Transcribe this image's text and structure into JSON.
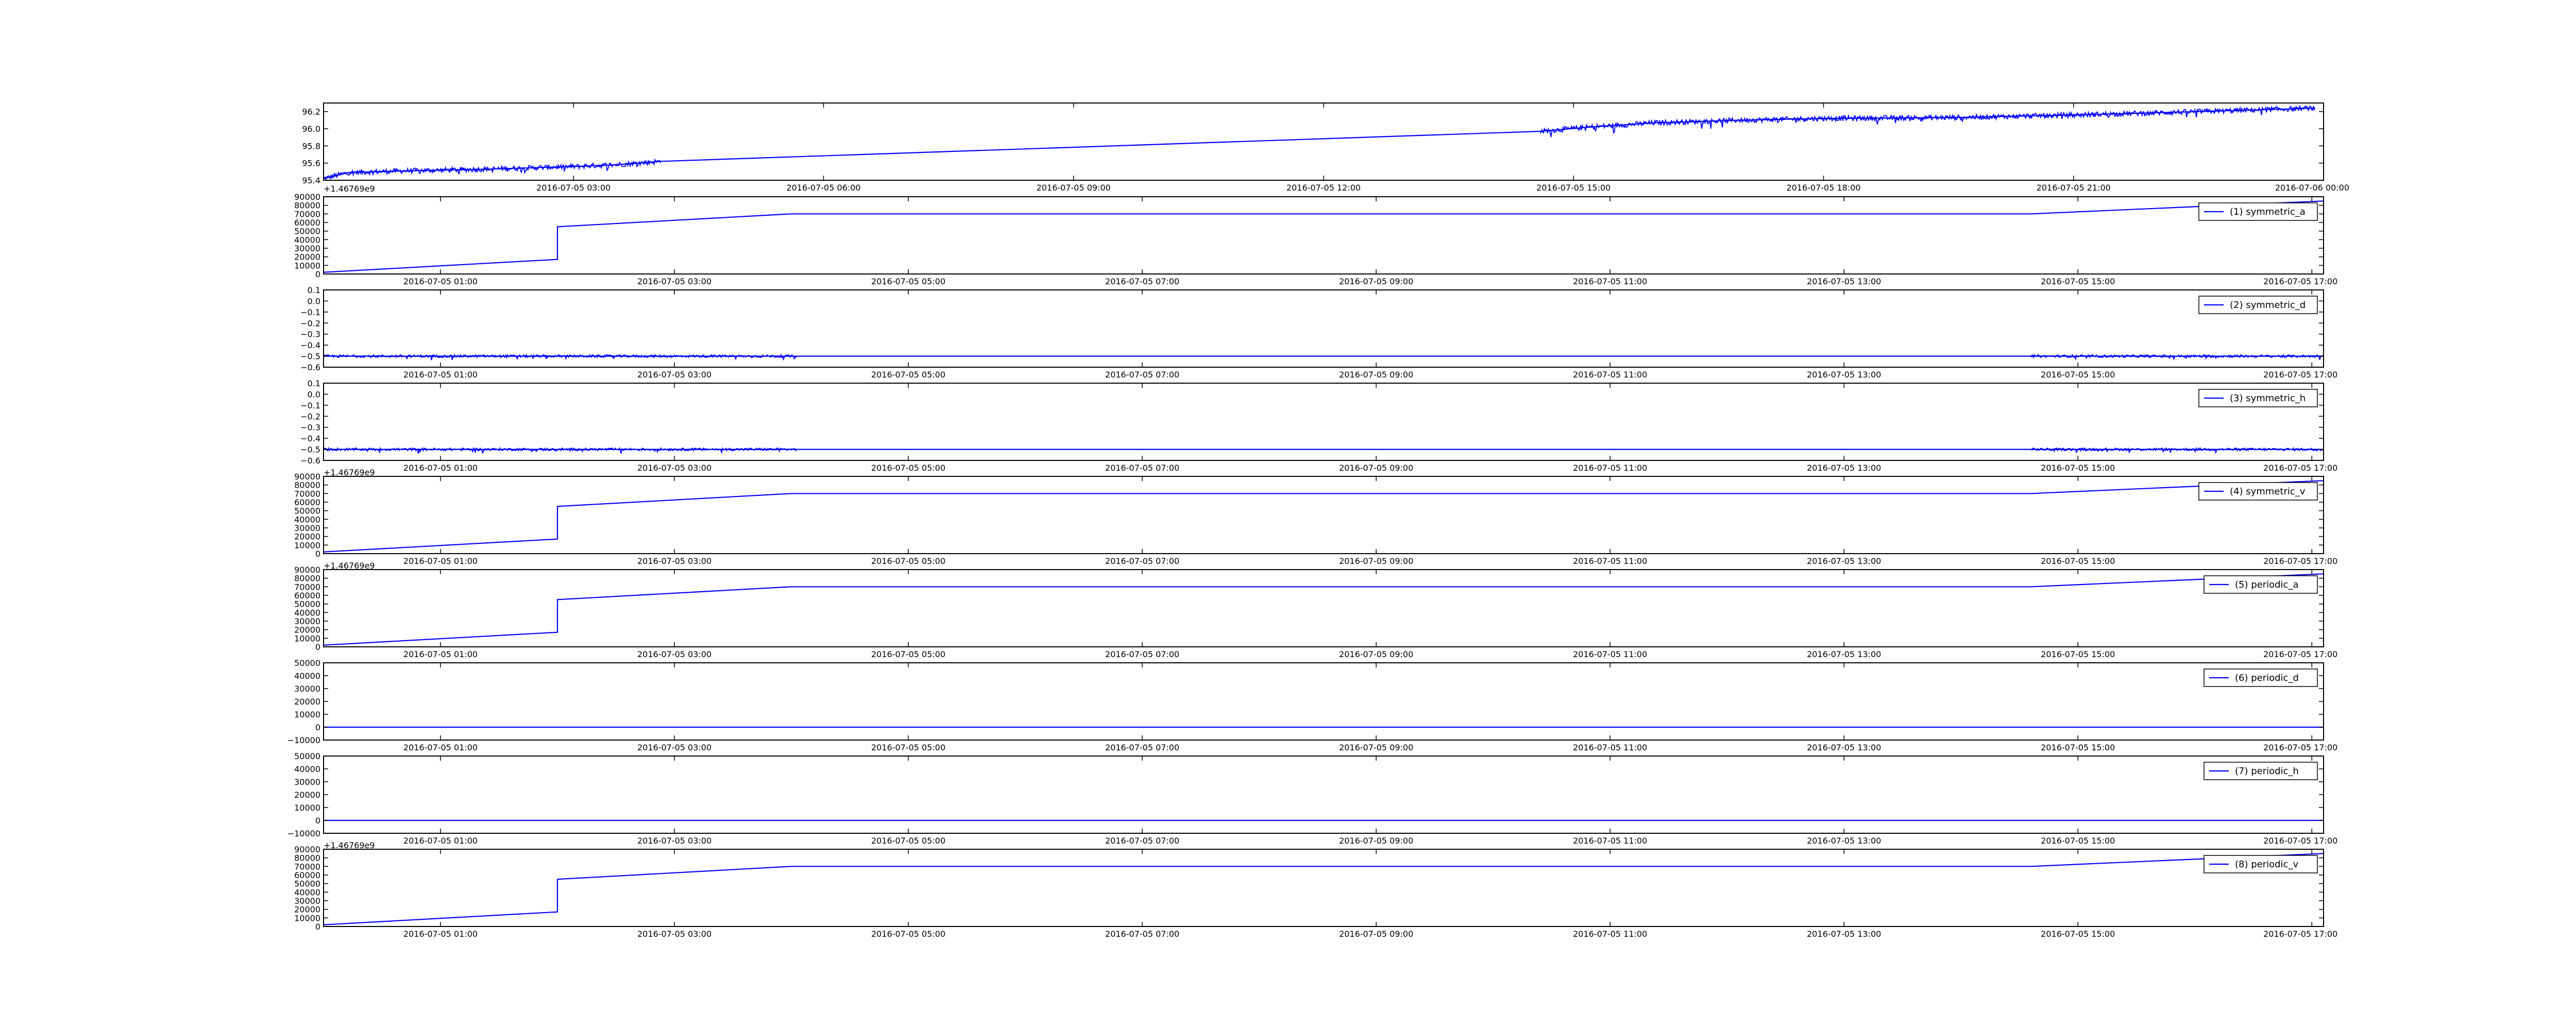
{
  "line_color": "#0000ff",
  "axis_color": "#000000",
  "chart_data": [
    {
      "id": "top",
      "type": "line",
      "offset_text": "+1.46769e9",
      "ylim": [
        95.4,
        96.3
      ],
      "yticks": [
        "95.4",
        "95.6",
        "95.8",
        "96.0",
        "96.2"
      ],
      "ytick_values": [
        95.4,
        95.6,
        95.8,
        96.0,
        96.2
      ],
      "xlim": [
        0.0,
        24.0
      ],
      "xticks": [
        "2016-07-05 03:00",
        "2016-07-05 06:00",
        "2016-07-05 09:00",
        "2016-07-05 12:00",
        "2016-07-05 15:00",
        "2016-07-05 18:00",
        "2016-07-05 21:00",
        "2016-07-06 00:00"
      ],
      "xtick_values": [
        3,
        6,
        9,
        12,
        15,
        18,
        21,
        24
      ],
      "legend": "",
      "noise": 0.03,
      "noise_segments": [
        [
          0.0,
          4.05
        ],
        [
          14.6,
          23.9
        ]
      ],
      "x": [
        0.0,
        0.3,
        1.0,
        2.0,
        3.0,
        3.5,
        4.05,
        14.6,
        15.2,
        16.0,
        17.0,
        18.0,
        19.5,
        21.0,
        22.5,
        23.9
      ],
      "y": [
        95.42,
        95.49,
        95.51,
        95.53,
        95.56,
        95.58,
        95.62,
        95.97,
        96.02,
        96.07,
        96.1,
        96.12,
        96.13,
        96.16,
        96.2,
        96.24
      ]
    },
    {
      "id": "symmetric_a",
      "type": "line",
      "offset_text": "",
      "ylim": [
        0,
        90000
      ],
      "yticks": [
        "0",
        "10000",
        "20000",
        "30000",
        "40000",
        "50000",
        "60000",
        "70000",
        "80000",
        "90000"
      ],
      "ytick_values": [
        0,
        10000,
        20000,
        30000,
        40000,
        50000,
        60000,
        70000,
        80000,
        90000
      ],
      "xlim": [
        0.0,
        17.1
      ],
      "xticks": [
        "2016-07-05 01:00",
        "2016-07-05 03:00",
        "2016-07-05 05:00",
        "2016-07-05 07:00",
        "2016-07-05 09:00",
        "2016-07-05 11:00",
        "2016-07-05 13:00",
        "2016-07-05 15:00",
        "2016-07-05 17:00"
      ],
      "xtick_values": [
        1,
        3,
        5,
        7,
        9,
        11,
        13,
        15,
        17
      ],
      "legend": "(1) symmetric_a",
      "noise": 0,
      "noise_segments": [],
      "x": [
        0.0,
        2.0,
        2.0,
        4.0,
        14.6,
        17.1
      ],
      "y": [
        2000,
        17000,
        55000,
        70000,
        70000,
        85000
      ]
    },
    {
      "id": "symmetric_d",
      "type": "line",
      "offset_text": "",
      "ylim": [
        -0.6,
        0.1
      ],
      "yticks": [
        "−0.6",
        "−0.5",
        "−0.4",
        "−0.3",
        "−0.2",
        "−0.1",
        "0.0",
        "0.1"
      ],
      "ytick_values": [
        -0.6,
        -0.5,
        -0.4,
        -0.3,
        -0.2,
        -0.1,
        0.0,
        0.1
      ],
      "xlim": [
        0.0,
        17.1
      ],
      "xticks": [
        "2016-07-05 01:00",
        "2016-07-05 03:00",
        "2016-07-05 05:00",
        "2016-07-05 07:00",
        "2016-07-05 09:00",
        "2016-07-05 11:00",
        "2016-07-05 13:00",
        "2016-07-05 15:00",
        "2016-07-05 17:00"
      ],
      "xtick_values": [
        1,
        3,
        5,
        7,
        9,
        11,
        13,
        15,
        17
      ],
      "legend": "(2) symmetric_d",
      "noise": 0.012,
      "noise_segments": [
        [
          0.0,
          4.05
        ],
        [
          14.6,
          17.1
        ]
      ],
      "x": [
        0.0,
        4.05,
        14.6,
        17.1
      ],
      "y": [
        -0.5,
        -0.5,
        -0.5,
        -0.5
      ]
    },
    {
      "id": "symmetric_h",
      "type": "line",
      "offset_text": "",
      "ylim": [
        -0.6,
        0.1
      ],
      "yticks": [
        "−0.6",
        "−0.5",
        "−0.4",
        "−0.3",
        "−0.2",
        "−0.1",
        "0.0",
        "0.1"
      ],
      "ytick_values": [
        -0.6,
        -0.5,
        -0.4,
        -0.3,
        -0.2,
        -0.1,
        0.0,
        0.1
      ],
      "xlim": [
        0.0,
        17.1
      ],
      "xticks": [
        "2016-07-05 01:00",
        "2016-07-05 03:00",
        "2016-07-05 05:00",
        "2016-07-05 07:00",
        "2016-07-05 09:00",
        "2016-07-05 11:00",
        "2016-07-05 13:00",
        "2016-07-05 15:00",
        "2016-07-05 17:00"
      ],
      "xtick_values": [
        1,
        3,
        5,
        7,
        9,
        11,
        13,
        15,
        17
      ],
      "legend": "(3) symmetric_h",
      "noise": 0.012,
      "noise_segments": [
        [
          0.0,
          4.05
        ],
        [
          14.6,
          17.1
        ]
      ],
      "x": [
        0.0,
        4.05,
        14.6,
        17.1
      ],
      "y": [
        -0.5,
        -0.5,
        -0.5,
        -0.5
      ]
    },
    {
      "id": "symmetric_v",
      "type": "line",
      "offset_text": "+1.46769e9",
      "ylim": [
        0,
        90000
      ],
      "yticks": [
        "0",
        "10000",
        "20000",
        "30000",
        "40000",
        "50000",
        "60000",
        "70000",
        "80000",
        "90000"
      ],
      "ytick_values": [
        0,
        10000,
        20000,
        30000,
        40000,
        50000,
        60000,
        70000,
        80000,
        90000
      ],
      "xlim": [
        0.0,
        17.1
      ],
      "xticks": [
        "2016-07-05 01:00",
        "2016-07-05 03:00",
        "2016-07-05 05:00",
        "2016-07-05 07:00",
        "2016-07-05 09:00",
        "2016-07-05 11:00",
        "2016-07-05 13:00",
        "2016-07-05 15:00",
        "2016-07-05 17:00"
      ],
      "xtick_values": [
        1,
        3,
        5,
        7,
        9,
        11,
        13,
        15,
        17
      ],
      "legend": "(4) symmetric_v",
      "noise": 0,
      "noise_segments": [],
      "x": [
        0.0,
        2.0,
        2.0,
        4.0,
        14.6,
        17.1
      ],
      "y": [
        2000,
        17000,
        55000,
        70000,
        70000,
        85000
      ]
    },
    {
      "id": "periodic_a",
      "type": "line",
      "offset_text": "+1.46769e9",
      "ylim": [
        0,
        90000
      ],
      "yticks": [
        "0",
        "10000",
        "20000",
        "30000",
        "40000",
        "50000",
        "60000",
        "70000",
        "80000",
        "90000"
      ],
      "ytick_values": [
        0,
        10000,
        20000,
        30000,
        40000,
        50000,
        60000,
        70000,
        80000,
        90000
      ],
      "xlim": [
        0.0,
        17.1
      ],
      "xticks": [
        "2016-07-05 01:00",
        "2016-07-05 03:00",
        "2016-07-05 05:00",
        "2016-07-05 07:00",
        "2016-07-05 09:00",
        "2016-07-05 11:00",
        "2016-07-05 13:00",
        "2016-07-05 15:00",
        "2016-07-05 17:00"
      ],
      "xtick_values": [
        1,
        3,
        5,
        7,
        9,
        11,
        13,
        15,
        17
      ],
      "legend": "(5) periodic_a",
      "noise": 0,
      "noise_segments": [],
      "x": [
        0.0,
        2.0,
        2.0,
        4.0,
        14.6,
        17.1
      ],
      "y": [
        2000,
        17000,
        55000,
        70000,
        70000,
        85000
      ]
    },
    {
      "id": "periodic_d",
      "type": "line",
      "offset_text": "",
      "ylim": [
        -10000,
        50000
      ],
      "yticks": [
        "−10000",
        "0",
        "10000",
        "20000",
        "30000",
        "40000",
        "50000"
      ],
      "ytick_values": [
        -10000,
        0,
        10000,
        20000,
        30000,
        40000,
        50000
      ],
      "xlim": [
        0.0,
        17.1
      ],
      "xticks": [
        "2016-07-05 01:00",
        "2016-07-05 03:00",
        "2016-07-05 05:00",
        "2016-07-05 07:00",
        "2016-07-05 09:00",
        "2016-07-05 11:00",
        "2016-07-05 13:00",
        "2016-07-05 15:00",
        "2016-07-05 17:00"
      ],
      "xtick_values": [
        1,
        3,
        5,
        7,
        9,
        11,
        13,
        15,
        17
      ],
      "legend": "(6) periodic_d",
      "noise": 0,
      "noise_segments": [],
      "x": [
        0.0,
        17.1
      ],
      "y": [
        0,
        0
      ]
    },
    {
      "id": "periodic_h",
      "type": "line",
      "offset_text": "",
      "ylim": [
        -10000,
        50000
      ],
      "yticks": [
        "−10000",
        "0",
        "10000",
        "20000",
        "30000",
        "40000",
        "50000"
      ],
      "ytick_values": [
        -10000,
        0,
        10000,
        20000,
        30000,
        40000,
        50000
      ],
      "xlim": [
        0.0,
        17.1
      ],
      "xticks": [
        "2016-07-05 01:00",
        "2016-07-05 03:00",
        "2016-07-05 05:00",
        "2016-07-05 07:00",
        "2016-07-05 09:00",
        "2016-07-05 11:00",
        "2016-07-05 13:00",
        "2016-07-05 15:00",
        "2016-07-05 17:00"
      ],
      "xtick_values": [
        1,
        3,
        5,
        7,
        9,
        11,
        13,
        15,
        17
      ],
      "legend": "(7) periodic_h",
      "noise": 0,
      "noise_segments": [],
      "x": [
        0.0,
        17.1
      ],
      "y": [
        0,
        0
      ]
    },
    {
      "id": "periodic_v",
      "type": "line",
      "offset_text": "+1.46769e9",
      "ylim": [
        0,
        90000
      ],
      "yticks": [
        "0",
        "10000",
        "20000",
        "30000",
        "40000",
        "50000",
        "60000",
        "70000",
        "80000",
        "90000"
      ],
      "ytick_values": [
        0,
        10000,
        20000,
        30000,
        40000,
        50000,
        60000,
        70000,
        80000,
        90000
      ],
      "xlim": [
        0.0,
        17.1
      ],
      "xticks": [
        "2016-07-05 01:00",
        "2016-07-05 03:00",
        "2016-07-05 05:00",
        "2016-07-05 07:00",
        "2016-07-05 09:00",
        "2016-07-05 11:00",
        "2016-07-05 13:00",
        "2016-07-05 15:00",
        "2016-07-05 17:00"
      ],
      "xtick_values": [
        1,
        3,
        5,
        7,
        9,
        11,
        13,
        15,
        17
      ],
      "legend": "(8) periodic_v",
      "noise": 0,
      "noise_segments": [],
      "x": [
        0.0,
        2.0,
        2.0,
        4.0,
        14.6,
        17.1
      ],
      "y": [
        2000,
        17000,
        55000,
        70000,
        70000,
        85000
      ]
    }
  ]
}
